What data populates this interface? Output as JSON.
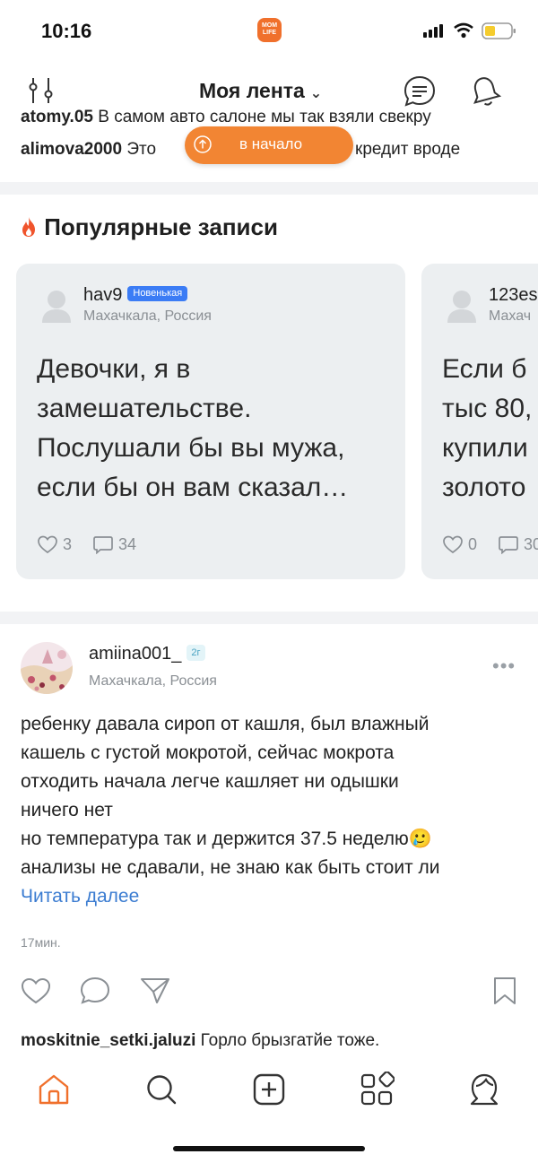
{
  "status_bar": {
    "time": "10:16",
    "app_badge": "MOM LIFE"
  },
  "header": {
    "title": "Моя лента"
  },
  "prev_comments": [
    {
      "user": "atomy.05",
      "text": "В самом авто салоне мы так взяли свекру"
    },
    {
      "user": "alimova2000",
      "text_before": "Это",
      "text_after": "кредит вроде"
    }
  ],
  "scroll_top_pill": {
    "label": "в начало"
  },
  "popular": {
    "title": "Популярные записи",
    "cards": [
      {
        "user": "hav9",
        "badge": "Новенькая",
        "location": "Махачкала, Россия",
        "text": "Девочки, я в замешательстве. Послушали бы вы мужа, если бы он вам сказал…",
        "likes": "3",
        "comments": "34"
      },
      {
        "user": "123es",
        "location": "Махач",
        "text_lines": [
          "Если б",
          "тыс 80,",
          "купили",
          "золото"
        ],
        "likes": "0",
        "comments": "30"
      }
    ]
  },
  "post": {
    "user": "amiina001_",
    "age_badge": "2г",
    "location": "Махачкала, Россия",
    "text_lines": [
      "ребенку давала сироп от кашля, был влажный",
      "кашель с густой мокротой, сейчас мокрота",
      "отходить начала легче кашляет ни одышки",
      "ничего нет",
      "но температура так и держится 37.5 неделю🥲",
      "анализы не сдавали, не знаю как быть стоит ли"
    ],
    "read_more": "Читать далее",
    "time": "17мин.",
    "last_comment": {
      "user": "moskitnie_setki.jaluzi",
      "text": "Горло брызгатйе тоже."
    }
  },
  "colors": {
    "accent": "#f0702c",
    "link": "#3b7cd1",
    "badge_blue": "#3b7cf5"
  },
  "tab_bar": [
    "home-icon",
    "search-icon",
    "create-icon",
    "services-icon",
    "profile-icon"
  ]
}
